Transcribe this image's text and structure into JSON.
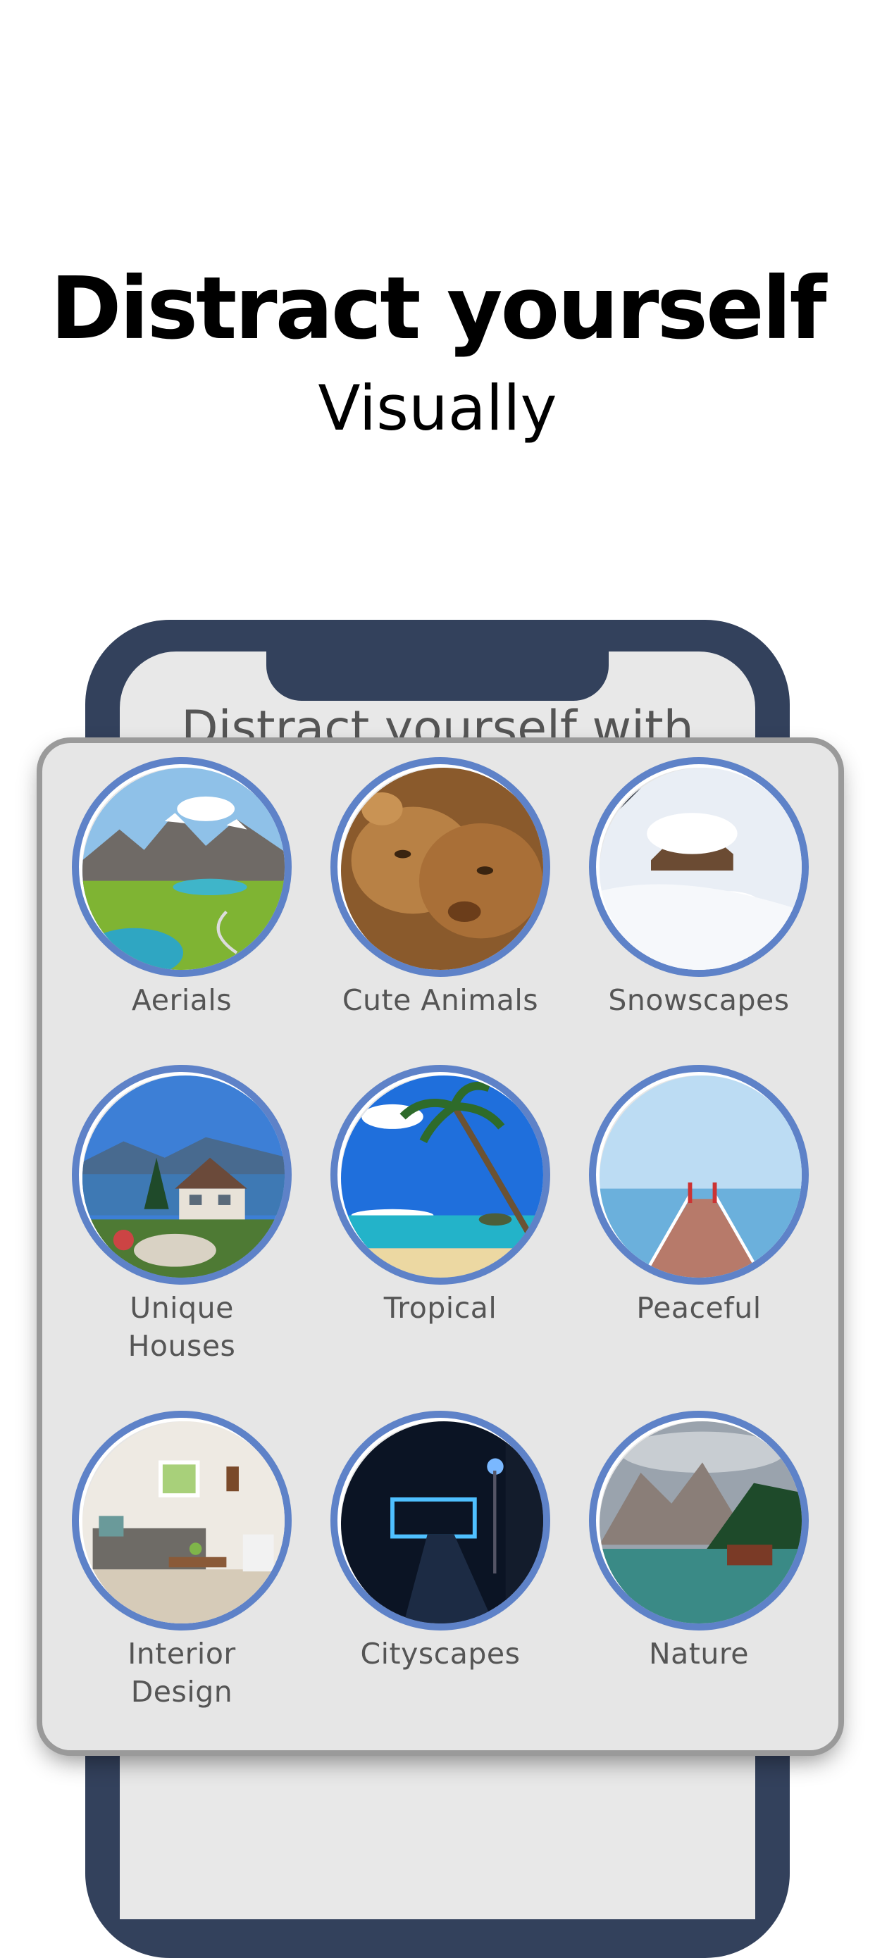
{
  "header": {
    "title": "Distract yourself",
    "subtitle": "Visually"
  },
  "phone_screen": {
    "partial_text": "Distract yourself with"
  },
  "categories": [
    {
      "label": "Aerials",
      "icon": "alpine-lake-aerial-image"
    },
    {
      "label": "Cute Animals",
      "icon": "lion-cubs-image"
    },
    {
      "label": "Snowscapes",
      "icon": "snowy-cabins-image"
    },
    {
      "label": "Unique\nHouses",
      "icon": "lakeside-house-image"
    },
    {
      "label": "Tropical",
      "icon": "palm-beach-image"
    },
    {
      "label": "Peaceful",
      "icon": "ocean-pier-image"
    },
    {
      "label": "Interior\nDesign",
      "icon": "living-room-image"
    },
    {
      "label": "Cityscapes",
      "icon": "night-walkway-image"
    },
    {
      "label": "Nature",
      "icon": "mountain-lake-image"
    }
  ],
  "colors": {
    "ring": "#5e82c8",
    "phone_frame": "#33415c",
    "card_bg": "#e6e6e6"
  }
}
